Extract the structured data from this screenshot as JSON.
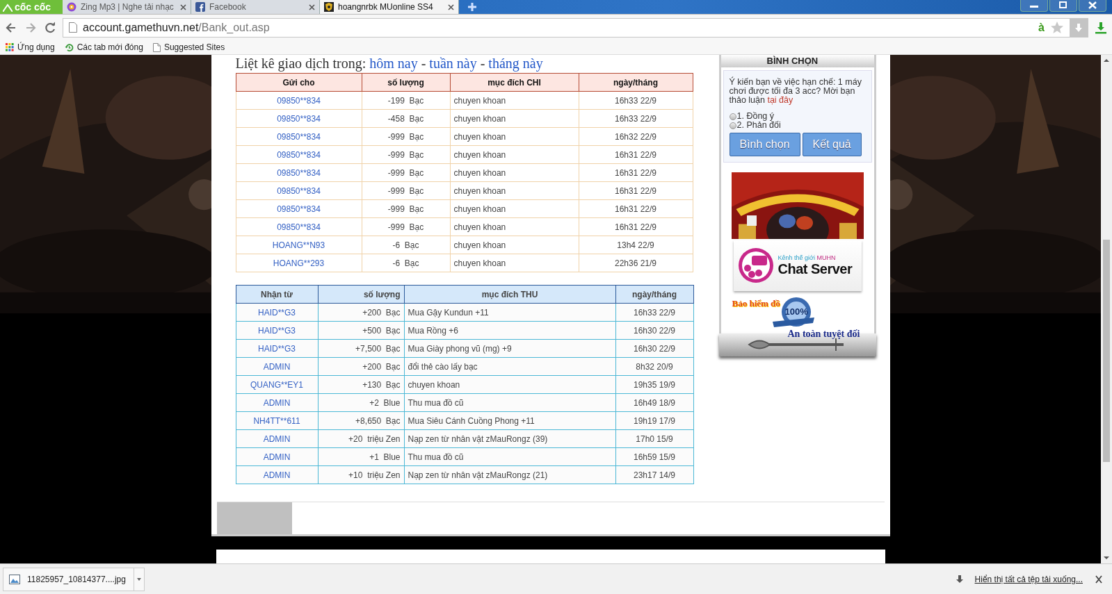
{
  "browser": {
    "logo": "cốc cốc",
    "tabs": [
      {
        "title": "Zing Mp3 | Nghe tải nhạc",
        "selected": false
      },
      {
        "title": "Facebook",
        "selected": false
      },
      {
        "title": "hoangnrbk MUonline SS4",
        "selected": true
      }
    ],
    "address": {
      "host": "account.gamethuvn.net",
      "path": "/Bank_out.asp"
    },
    "ime_indicator": "à",
    "bookmarks": [
      "Ứng dụng",
      "Các tab mới đóng",
      "Suggested Sites"
    ]
  },
  "heading": {
    "text": "Liệt kê giao dịch trong:",
    "separator": "-",
    "links": [
      "hôm nay",
      "tuần này",
      "tháng này"
    ]
  },
  "spend_table": {
    "columns": [
      "Gửi cho",
      "số lượng",
      "mục đích CHI",
      "ngày/tháng"
    ],
    "rows": [
      {
        "party": "09850**834",
        "amount": "-199  Bạc",
        "purpose": "chuyen khoan",
        "time": "16h33 22/9"
      },
      {
        "party": "09850**834",
        "amount": "-458  Bạc",
        "purpose": "chuyen khoan",
        "time": "16h33 22/9"
      },
      {
        "party": "09850**834",
        "amount": "-999  Bạc",
        "purpose": "chuyen khoan",
        "time": "16h32 22/9"
      },
      {
        "party": "09850**834",
        "amount": "-999  Bạc",
        "purpose": "chuyen khoan",
        "time": "16h31 22/9"
      },
      {
        "party": "09850**834",
        "amount": "-999  Bạc",
        "purpose": "chuyen khoan",
        "time": "16h31 22/9"
      },
      {
        "party": "09850**834",
        "amount": "-999  Bạc",
        "purpose": "chuyen khoan",
        "time": "16h31 22/9"
      },
      {
        "party": "09850**834",
        "amount": "-999  Bạc",
        "purpose": "chuyen khoan",
        "time": "16h31 22/9"
      },
      {
        "party": "09850**834",
        "amount": "-999  Bạc",
        "purpose": "chuyen khoan",
        "time": "16h31 22/9"
      },
      {
        "party": "HOANG**N93",
        "amount": "-6  Bạc",
        "purpose": "chuyen khoan",
        "time": "13h4 22/9"
      },
      {
        "party": "HOANG**293",
        "amount": "-6  Bạc",
        "purpose": "chuyen khoan",
        "time": "22h36 21/9"
      }
    ]
  },
  "income_table": {
    "columns": [
      "Nhận từ",
      "số lượng",
      "mục đích THU",
      "ngày/tháng"
    ],
    "rows": [
      {
        "party": "HAID**G3",
        "amount": "+200  Bạc",
        "purpose": "Mua Gậy Kundun +11",
        "time": "16h33 22/9"
      },
      {
        "party": "HAID**G3",
        "amount": "+500  Bạc",
        "purpose": "Mua Rồng +6",
        "time": "16h30 22/9"
      },
      {
        "party": "HAID**G3",
        "amount": "+7,500  Bạc",
        "purpose": "Mua Giày phong vũ (mg) +9",
        "time": "16h30 22/9"
      },
      {
        "party": "ADMIN",
        "amount": "+200  Bạc",
        "purpose": "đổi thẻ cào lấy bạc",
        "time": "8h32 20/9"
      },
      {
        "party": "QUANG**EY1",
        "amount": "+130  Bạc",
        "purpose": "chuyen khoan",
        "time": "19h35 19/9"
      },
      {
        "party": "ADMIN",
        "amount": "+2  Blue",
        "purpose": "Thu mua đồ cũ",
        "time": "16h49 18/9"
      },
      {
        "party": "NH4TT**611",
        "amount": "+8,650  Bạc",
        "purpose": "Mua Siêu Cánh Cuồng Phong +11",
        "time": "19h19 17/9"
      },
      {
        "party": "ADMIN",
        "amount": "+20  triệu Zen",
        "purpose": "Nạp zen từ nhân vật zMauRongz (39)",
        "time": "17h0 15/9"
      },
      {
        "party": "ADMIN",
        "amount": "+1  Blue",
        "purpose": "Thu mua đồ cũ",
        "time": "16h59 15/9"
      },
      {
        "party": "ADMIN",
        "amount": "+10  triệu Zen",
        "purpose": "Nạp zen từ nhân vật zMauRongz (21)",
        "time": "23h17 14/9"
      }
    ]
  },
  "poll": {
    "title": "BÌNH CHỌN",
    "question": "Ý kiến bạn về việc hạn chế: 1 máy chơi được tối đa 3 acc? Mời bạn thảo luận",
    "link": "tại đây",
    "options": [
      {
        "label": "1. Đồng ý",
        "selected": false
      },
      {
        "label": "2. Phản đối",
        "selected": false
      }
    ],
    "buttons": [
      "Bình chọn",
      "Kết quả"
    ]
  },
  "chat_banner": {
    "caption": "Kênh thế giới",
    "caption_highlight": "MUHN",
    "title": "Chat Server"
  },
  "insurance_banner": {
    "line1": "Bảo hiểm đồ",
    "badge": "100%",
    "line2": "An toàn tuyệt đối"
  },
  "downloads": {
    "file": "11825957_10814377....jpg",
    "show_all": "Hiển thị tất cả tệp tải xuống..."
  }
}
